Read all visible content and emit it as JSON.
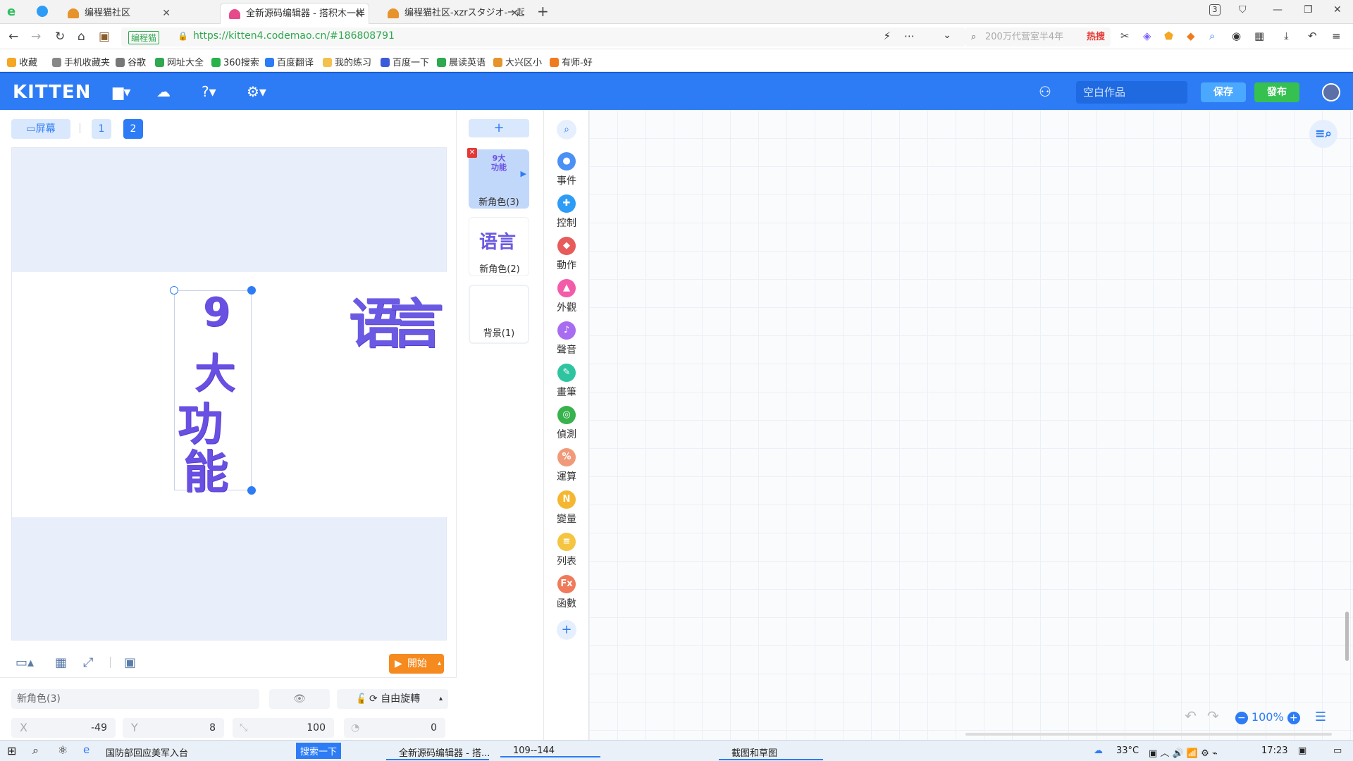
{
  "browser": {
    "tabs": [
      {
        "title": "编程猫社区"
      },
      {
        "title": "全新源码编辑器 - 搭积木一样"
      },
      {
        "title": "编程猫社区-xzrスタジオ-一起"
      }
    ],
    "url": "https://kitten4.codemao.cn/#186808791",
    "site_badge": "编程猫",
    "search_placeholder": "200万代营室半4年",
    "hot_label": "热搜",
    "tab_count": "3",
    "bookmarks": [
      {
        "label": "收藏",
        "color": "#f5a623"
      },
      {
        "label": "手机收藏夹",
        "color": "#888888"
      },
      {
        "label": "谷歌",
        "color": "#777777"
      },
      {
        "label": "网址大全",
        "color": "#2fa84f"
      },
      {
        "label": "360搜索",
        "color": "#27b34a"
      },
      {
        "label": "百度翻译",
        "color": "#2d7cf6"
      },
      {
        "label": "我的练习",
        "color": "#f2c14e"
      },
      {
        "label": "百度一下",
        "color": "#3b5bdb"
      },
      {
        "label": "晨读英语",
        "color": "#2fa84f"
      },
      {
        "label": "大兴区小",
        "color": "#e6932c"
      },
      {
        "label": "有师-好",
        "color": "#f07b1f"
      }
    ]
  },
  "app": {
    "logo": "KITTEN",
    "project_name": "空白作品",
    "save_label": "保存",
    "publish_label": "發布",
    "colors": {
      "header": "#2d7cf6",
      "save": "#4aa8ff",
      "publish": "#35c04f",
      "start": "#f58a1f"
    }
  },
  "stage": {
    "screen_label": "屏幕",
    "pages": [
      "1",
      "2"
    ],
    "start_label": "開始",
    "sprite_chars": [
      "9",
      "大",
      "功",
      "能"
    ],
    "other_chars": [
      "语",
      "言"
    ]
  },
  "properties": {
    "sprite_name": "新角色(3)",
    "rotation_mode": "自由旋轉",
    "x_label": "X",
    "x_value": "-49",
    "y_label": "Y",
    "y_value": "8",
    "size_value": "100",
    "direction_value": "0"
  },
  "sprites": {
    "add_label": "+",
    "items": [
      {
        "name": "新角色(3)",
        "thumb": "9大功能",
        "selected": true
      },
      {
        "name": "新角色(2)",
        "thumb": "语言",
        "selected": false
      },
      {
        "name": "背景(1)",
        "thumb": "",
        "selected": false
      }
    ]
  },
  "categories": [
    {
      "label": "事件",
      "color": "#4a90f5",
      "glyph": "●"
    },
    {
      "label": "控制",
      "color": "#2d9cf6",
      "glyph": "✚"
    },
    {
      "label": "動作",
      "color": "#e85b5b",
      "glyph": "◆"
    },
    {
      "label": "外觀",
      "color": "#f25ca8",
      "glyph": "▲"
    },
    {
      "label": "聲音",
      "color": "#a86cf0",
      "glyph": "♪"
    },
    {
      "label": "畫筆",
      "color": "#2ec4a0",
      "glyph": "✎"
    },
    {
      "label": "偵測",
      "color": "#37b24d",
      "glyph": "◎"
    },
    {
      "label": "運算",
      "color": "#f09a7a",
      "glyph": "%"
    },
    {
      "label": "變量",
      "color": "#f5b731",
      "glyph": "N"
    },
    {
      "label": "列表",
      "color": "#f5c542",
      "glyph": "≡"
    },
    {
      "label": "函數",
      "color": "#f07a5a",
      "glyph": "Fx"
    }
  ],
  "workspace": {
    "zoom": "100%"
  },
  "taskbar": {
    "news": "国防部回应美军入台",
    "search_button": "搜索一下",
    "apps": [
      "全新源码编辑器 - 搭...",
      "109--144",
      "截图和草图"
    ],
    "weather": "33°C",
    "time": "17:23"
  }
}
